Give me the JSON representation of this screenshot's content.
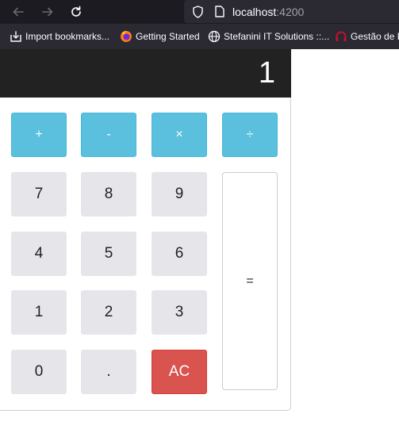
{
  "browser": {
    "url_host": "localhost",
    "url_port": ":4200",
    "bookmarks": [
      {
        "label": "Import bookmarks...",
        "icon": "import-icon"
      },
      {
        "label": "Getting Started",
        "icon": "firefox-icon"
      },
      {
        "label": "Stefanini IT Solutions ::...",
        "icon": "globe-icon"
      },
      {
        "label": "Gestão de P",
        "icon": "headset-icon"
      }
    ]
  },
  "calculator": {
    "display": "1",
    "operators": {
      "add": "+",
      "subtract": "-",
      "multiply": "×",
      "divide": "÷"
    },
    "keys": {
      "seven": "7",
      "eight": "8",
      "nine": "9",
      "four": "4",
      "five": "5",
      "six": "6",
      "one": "1",
      "two": "2",
      "three": "3",
      "zero": "0",
      "decimal": ".",
      "clear": "AC",
      "equals": "="
    }
  },
  "colors": {
    "display_bg": "#222222",
    "operator": "#5bc0de",
    "number": "#e6e6ea",
    "clear": "#d9534f"
  }
}
